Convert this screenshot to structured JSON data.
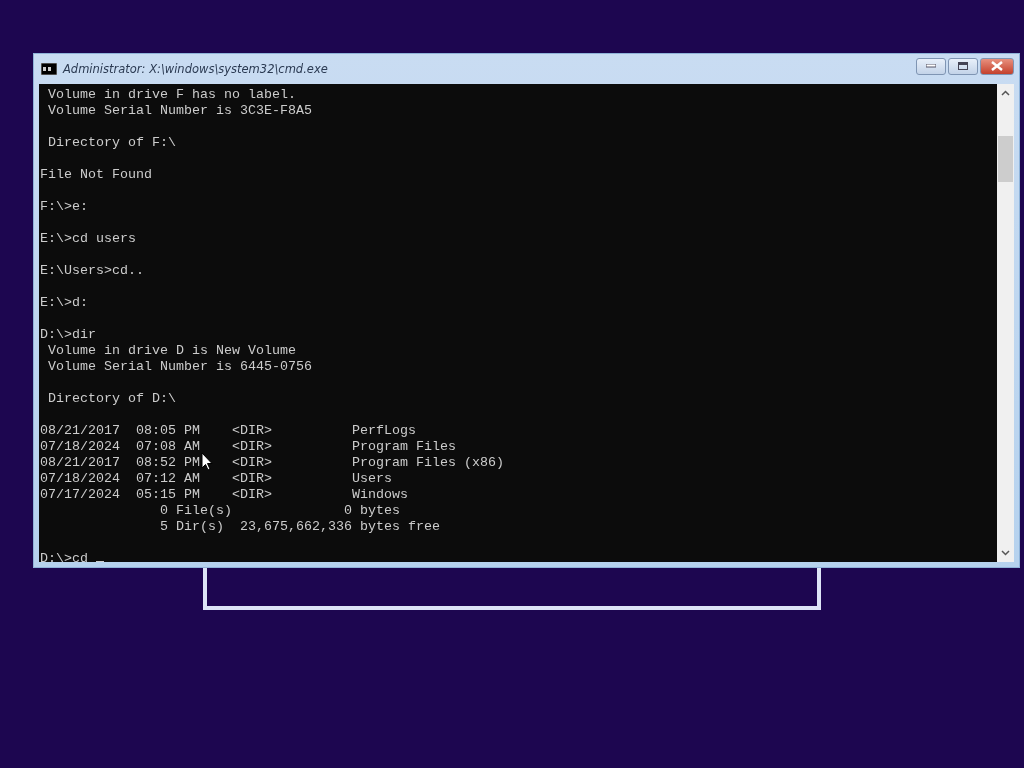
{
  "window": {
    "title": "Administrator: X:\\windows\\system32\\cmd.exe"
  },
  "console": {
    "blocks": [
      [
        " Volume in drive F has no label.",
        " Volume Serial Number is 3C3E-F8A5"
      ],
      [
        " Directory of F:\\"
      ],
      [
        "File Not Found"
      ],
      [
        "F:\\>e:"
      ],
      [
        "E:\\>cd users"
      ],
      [
        "E:\\Users>cd.."
      ],
      [
        "E:\\>d:"
      ],
      [
        "D:\\>dir",
        " Volume in drive D is New Volume",
        " Volume Serial Number is 6445-0756"
      ],
      [
        " Directory of D:\\"
      ]
    ],
    "entries": [
      {
        "date": "08/21/2017",
        "time": "08:05 PM",
        "type": "<DIR>",
        "name": "PerfLogs"
      },
      {
        "date": "07/18/2024",
        "time": "07:08 AM",
        "type": "<DIR>",
        "name": "Program Files"
      },
      {
        "date": "08/21/2017",
        "time": "08:52 PM",
        "type": "<DIR>",
        "name": "Program Files (x86)"
      },
      {
        "date": "07/18/2024",
        "time": "07:12 AM",
        "type": "<DIR>",
        "name": "Users"
      },
      {
        "date": "07/17/2024",
        "time": "05:15 PM",
        "type": "<DIR>",
        "name": "Windows"
      }
    ],
    "summary": [
      "               0 File(s)              0 bytes",
      "               5 Dir(s)  23,675,662,336 bytes free"
    ],
    "prompt": "D:\\>cd "
  }
}
